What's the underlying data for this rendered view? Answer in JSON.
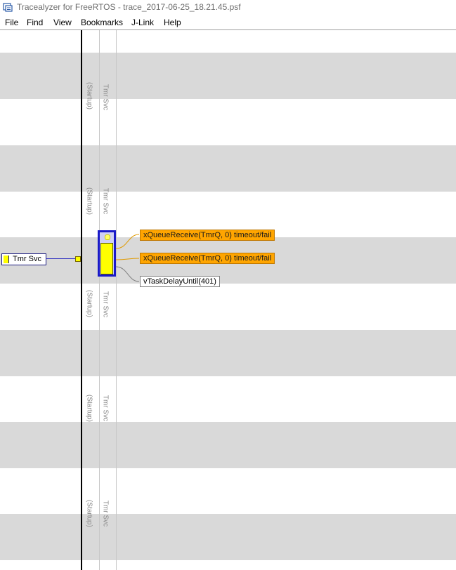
{
  "window": {
    "title": "Tracealyzer for FreeRTOS - trace_2017-06-25_18.21.45.psf"
  },
  "menu": [
    "File",
    "Find",
    "View",
    "Bookmarks",
    "J-Link",
    "Help"
  ],
  "trace": {
    "column_labels": [
      {
        "startup": "(Startup)",
        "task": "Tmr Svc"
      },
      {
        "startup": "(Startup)",
        "task": "Tmr Svc"
      },
      {
        "startup": "(Startup)",
        "task": "Tmr Svc"
      },
      {
        "startup": "(Startup)",
        "task": "Tmr Svc"
      },
      {
        "startup": "(Startup)",
        "task": "Tmr Svc"
      }
    ],
    "actor": "Tmr Svc",
    "events": [
      "xQueueReceive(TmrQ, 0) timeout/fail",
      "xQueueReceive(TmrQ, 0) timeout/fail",
      "vTaskDelayUntil(401)"
    ]
  },
  "colors": {
    "event_orange": "#ffa500",
    "task_yellow": "#ffff00",
    "selection_blue": "#1a1ac8",
    "band_gray": "#d9d9d9"
  },
  "icons": {
    "app": "tracealyzer-app-icon"
  }
}
